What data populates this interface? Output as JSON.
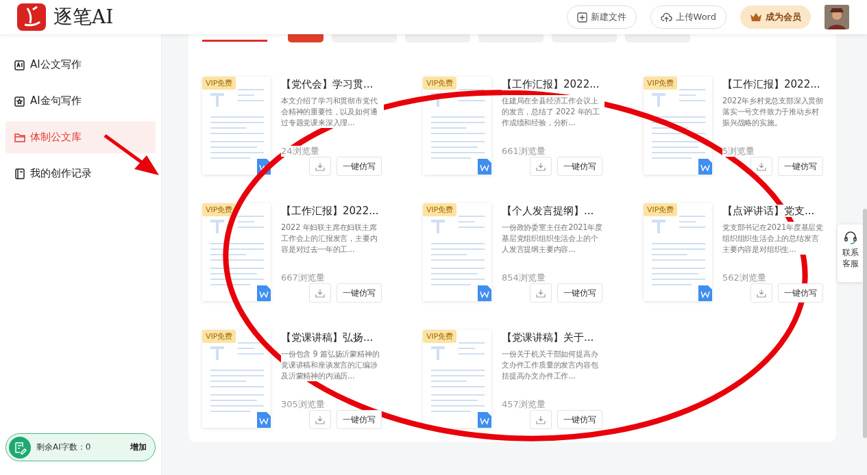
{
  "header": {
    "logo_text": "逐笔AI",
    "buttons": [
      {
        "label": "新建文件",
        "kind": "new"
      },
      {
        "label": "上传Word",
        "kind": "upload"
      }
    ],
    "member_button": "成为会员"
  },
  "sidebar": {
    "items": [
      {
        "label": "AI公文写作",
        "kind": "ai",
        "selected": false
      },
      {
        "label": "AI金句写作",
        "kind": "star",
        "selected": false
      },
      {
        "label": "体制公文库",
        "kind": "folder",
        "selected": true
      },
      {
        "label": "我的创作记录",
        "kind": "record",
        "selected": false
      }
    ],
    "quota": {
      "label": "剩余AI字数：0",
      "action": "增加"
    }
  },
  "filter_tabs": [
    {
      "selected": true
    },
    {
      "selected": false
    },
    {
      "selected": false
    },
    {
      "selected": false
    },
    {
      "selected": false
    },
    {
      "selected": false
    }
  ],
  "cards": [
    {
      "badge": "VIP免费",
      "title": "【党代会】学习贯...",
      "description": "本文介绍了学习和贯彻市党代会精神的重要性，以及如何通过专题党课来深入理...",
      "views_count": "24",
      "views_unit": "浏览量",
      "action": "一键仿写"
    },
    {
      "badge": "VIP免费",
      "title": "【工作汇报】2022...",
      "description": "住建局在全县经济工作会议上的发言，总结了 2022 年的工作成绩和经验，分析...",
      "views_count": "661",
      "views_unit": "浏览量",
      "action": "一键仿写"
    },
    {
      "badge": "VIP免费",
      "title": "【工作汇报】2022...",
      "description": "2022年乡村党总支部深入贯彻落实一号文件致力于推动乡村振兴战略的实施。",
      "views_count": "5",
      "views_unit": "浏览量",
      "action": "一键仿写"
    },
    {
      "badge": "VIP免费",
      "title": "【工作汇报】2022...",
      "description": "2022 年妇联主席在妇联主席工作会上的汇报发言，主要内容是对过去一年的工...",
      "views_count": "667",
      "views_unit": "浏览量",
      "action": "一键仿写"
    },
    {
      "badge": "VIP免费",
      "title": "【个人发言提纲】...",
      "description": "一份政协委室主任在2021年度基层党组织组织生活会上的个人发言提纲主要内容...",
      "views_count": "854",
      "views_unit": "浏览量",
      "action": "一键仿写"
    },
    {
      "badge": "VIP免费",
      "title": "【点评讲话】党支...",
      "description": "党支部书记在2021年度基层党组织组织生活会上的总结发言主要内容是对组织生...",
      "views_count": "562",
      "views_unit": "浏览量",
      "action": "一键仿写"
    },
    {
      "badge": "VIP免费",
      "title": "【党课讲稿】弘扬...",
      "description": "一份包含 9 篇弘扬沂蒙精神的党课讲稿和座谈发言的汇编涉及沂蒙精神的内涵历...",
      "views_count": "305",
      "views_unit": "浏览量",
      "action": "一键仿写"
    },
    {
      "badge": "VIP免费",
      "title": "【党课讲稿】关于...",
      "description": "一份关于机关干部如何提高办文办件工作质量的发言内容包括提高办文办件工作...",
      "views_count": "457",
      "views_unit": "浏览量",
      "action": "一键仿写"
    }
  ],
  "support_button": "联系客服"
}
